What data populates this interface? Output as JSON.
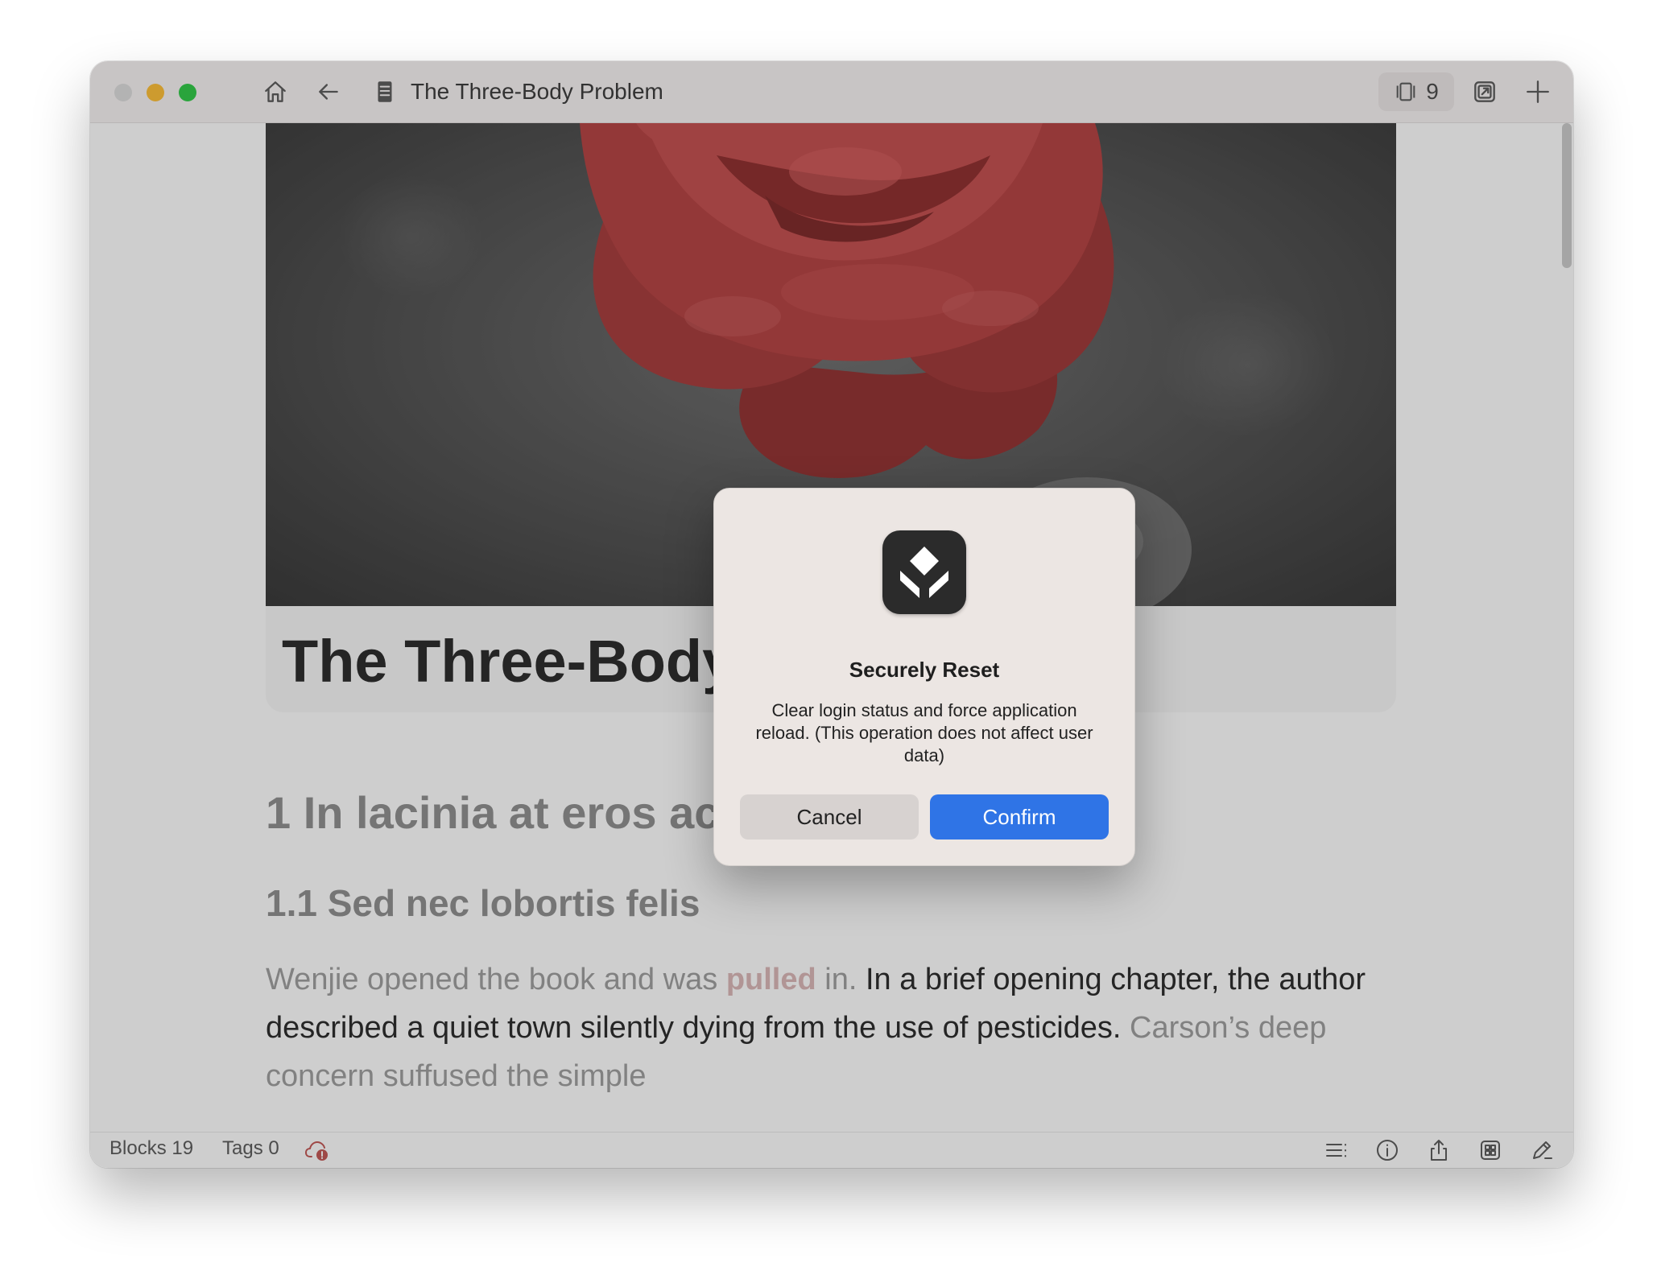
{
  "titlebar": {
    "doc_title": "The Three-Body Problem",
    "page_count": "9"
  },
  "document": {
    "title": "The Three-Body Problem",
    "heading1": "1 In lacinia at eros ac lobortis",
    "heading2": "1.1 Sed nec lobortis felis",
    "paragraph": {
      "p1": "Wenjie opened the book and was ",
      "highlight": "pulled",
      "p2": " in. ",
      "p3": "In a brief opening chapter, the author described a quiet town silently dying from the use of pesticides.",
      "p4": " Carson’s deep concern suffused the simple"
    }
  },
  "statusbar": {
    "blocks": "Blocks 19",
    "tags": "Tags 0"
  },
  "dialog": {
    "title": "Securely Reset",
    "message": "Clear login status and force application reload. (This operation does not affect user data)",
    "cancel_label": "Cancel",
    "confirm_label": "Confirm"
  },
  "colors": {
    "accent": "#2f74e6",
    "traffic_min": "#febc2e",
    "traffic_max": "#28c840",
    "rose": "#b23a3a"
  },
  "icons": [
    "home-icon",
    "back-arrow-icon",
    "document-icon",
    "pages-icon",
    "open-external-icon",
    "plus-icon",
    "cloud-sync-error-icon",
    "outline-icon",
    "info-icon",
    "share-icon",
    "grid-icon",
    "edit-icon",
    "app-logo-icon"
  ]
}
